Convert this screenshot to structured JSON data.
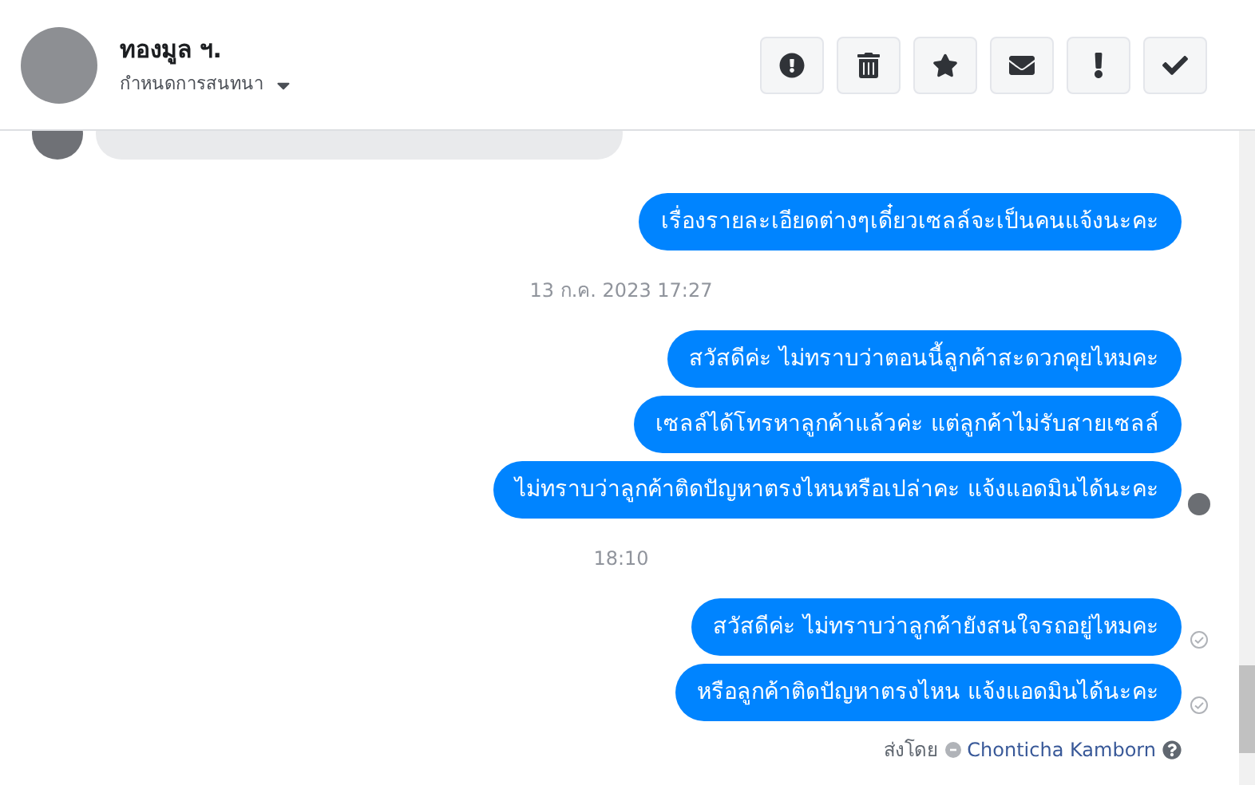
{
  "header": {
    "name": "ทองมูล ฯ.",
    "subtitle": "กำหนดการสนทนา"
  },
  "messages": [
    {
      "kind": "incoming_clipped"
    },
    {
      "kind": "outgoing",
      "text": "เรื่องรายละเอียดต่างๆเดี๋ยวเซลล์จะเป็นคนแจ้งนะคะ",
      "seen": false,
      "delivered": false
    },
    {
      "kind": "timestamp",
      "text": "13 ก.ค. 2023 17:27"
    },
    {
      "kind": "outgoing",
      "text": "สวัสดีค่ะ ไม่ทราบว่าตอนนี้ลูกค้าสะดวกคุยไหมคะ",
      "seen": false,
      "delivered": false
    },
    {
      "kind": "outgoing",
      "text": "เซลล์ได้โทรหาลูกค้าแล้วค่ะ แต่ลูกค้าไม่รับสายเซลล์",
      "seen": false,
      "delivered": false
    },
    {
      "kind": "outgoing",
      "text": "ไม่ทราบว่าลูกค้าติดปัญหาตรงไหนหรือเปล่าคะ แจ้งแอดมินได้นะคะ",
      "seen": true,
      "delivered": false
    },
    {
      "kind": "timestamp",
      "text": "18:10"
    },
    {
      "kind": "outgoing",
      "text": "สวัสดีค่ะ ไม่ทราบว่าลูกค้ายังสนใจรถอยู่ไหมคะ",
      "seen": false,
      "delivered": true
    },
    {
      "kind": "outgoing",
      "text": "หรือลูกค้าติดปัญหาตรงไหน แจ้งแอดมินได้นะคะ",
      "seen": false,
      "delivered": true
    }
  ],
  "sent_by": {
    "label": "ส่งโดย",
    "name": "Chonticha Kamborn"
  }
}
